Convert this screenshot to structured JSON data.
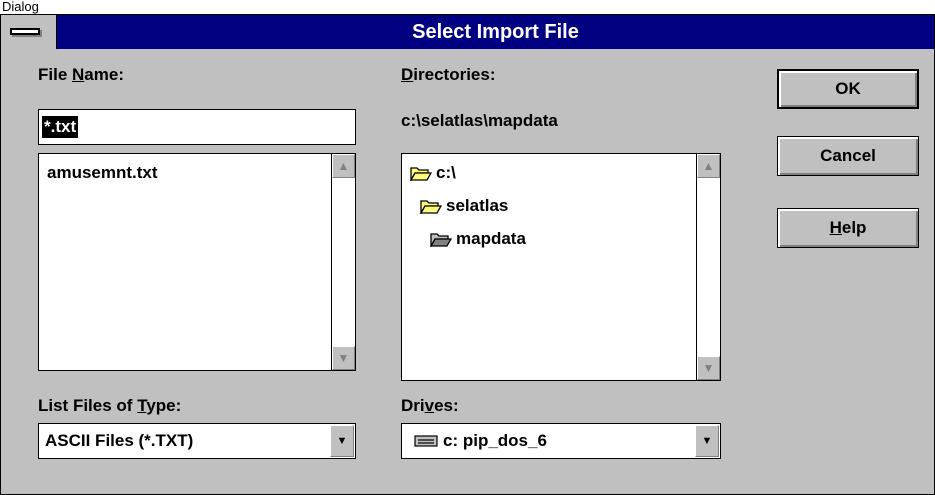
{
  "caption": "Dialog",
  "window": {
    "title": "Select Import File"
  },
  "filename": {
    "label_pre": "File ",
    "label_key": "N",
    "label_post": "ame:",
    "value": "*.txt"
  },
  "files": {
    "items": [
      "amusemnt.txt"
    ]
  },
  "directories": {
    "label_key": "D",
    "label_post": "irectories:",
    "path": "c:\\selatlas\\mapdata",
    "items": [
      {
        "name": "c:\\",
        "icon": "open-folder-icon"
      },
      {
        "name": "selatlas",
        "icon": "open-folder-icon"
      },
      {
        "name": "mapdata",
        "icon": "open-folder-icon"
      }
    ]
  },
  "filetype": {
    "label_pre": "List Files of ",
    "label_key": "T",
    "label_post": "ype:",
    "value": "ASCII Files (*.TXT)"
  },
  "drives": {
    "label_pre": "Dri",
    "label_key": "v",
    "label_post": "es:",
    "value": "c: pip_dos_6",
    "icon": "drive-icon"
  },
  "buttons": {
    "ok": "OK",
    "cancel": "Cancel",
    "help_key": "H",
    "help_post": "elp"
  },
  "icons": {
    "sysmenu": "system-menu-icon",
    "scroll_up": "scroll-up-arrow-icon",
    "scroll_down": "scroll-down-arrow-icon",
    "dropdown": "dropdown-arrow-icon"
  }
}
